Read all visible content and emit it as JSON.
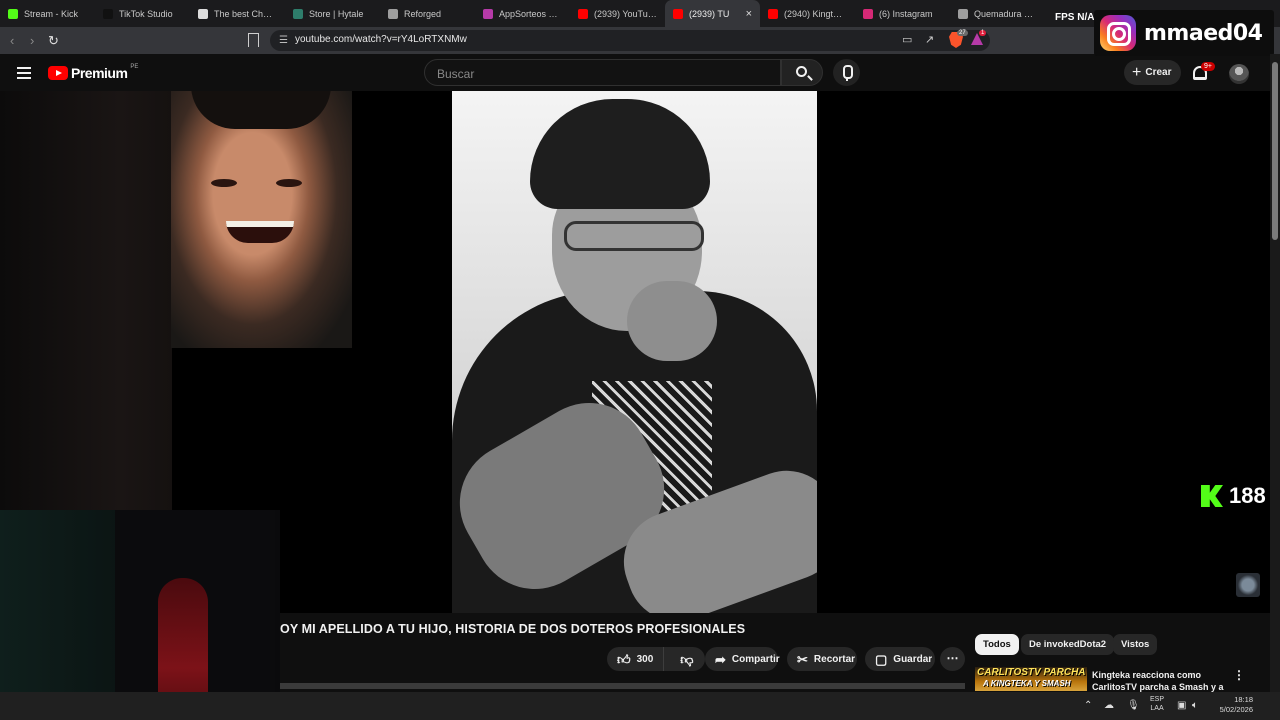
{
  "browser": {
    "tabs": [
      {
        "label": "Stream - Kick",
        "color": "#53fc18"
      },
      {
        "label": "TikTok Studio",
        "color": "#111111"
      },
      {
        "label": "The best ChatBot",
        "color": "#dddddd"
      },
      {
        "label": "Store | Hytale",
        "color": "#2e7d6b"
      },
      {
        "label": "Reforged",
        "color": "#9e9e9e"
      },
      {
        "label": "AppSorteos – Co",
        "color": "#b63aa8"
      },
      {
        "label": "(2939) YouTube",
        "color": "#ff0000"
      },
      {
        "label": "(2939) TU",
        "color": "#ff0000",
        "active": true
      },
      {
        "label": "(2940) Kingteka",
        "color": "#ff0000"
      },
      {
        "label": "(6) Instagram",
        "color": "#d62976"
      },
      {
        "label": "Quemadura de s",
        "color": "#9e9e9e"
      }
    ],
    "url": "youtube.com/watch?v=rY4LoRTXNMw",
    "brave_badge": "27",
    "rewards_badge": "1"
  },
  "overlay": {
    "fps_label": "FPS",
    "fps_value": "N/A",
    "instagram_handle": "mmaed04",
    "kick_viewers": "188"
  },
  "youtube": {
    "logo_text": "Premium",
    "region": "PE",
    "search_placeholder": "Buscar",
    "create_label": "Crear",
    "notifications_badge": "9+",
    "video_title": "OY MI APELLIDO A TU HIJO, HISTORIA DE DOS DOTEROS PROFESIONALES",
    "like_count": "300",
    "share_label": "Compartir",
    "clip_label": "Recortar",
    "save_label": "Guardar",
    "chips": [
      "Todos",
      "De invokedDota2",
      "Vistos"
    ],
    "recommendation": {
      "thumb_text": "CARLITOSTV PARCHA",
      "thumb_sub": "A KINGTEKA Y SMASH",
      "title": "Kingteka reacciona como CarlitosTV parcha a Smash y a"
    }
  },
  "taskbar": {
    "lang_top": "ESP",
    "lang_bottom": "LAA",
    "time": "18:18",
    "date": "5/02/2026"
  }
}
